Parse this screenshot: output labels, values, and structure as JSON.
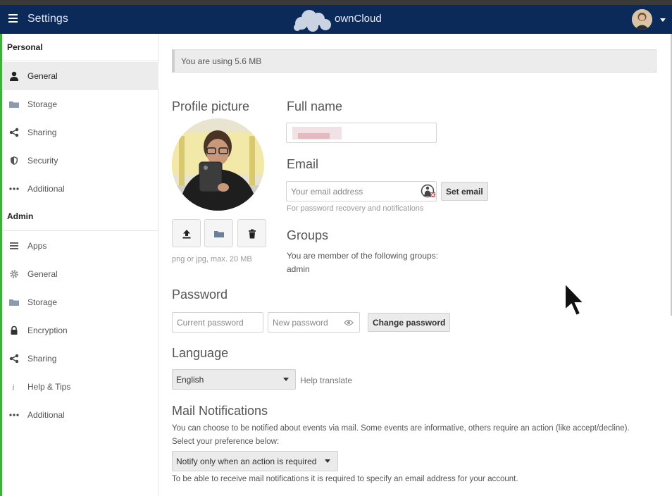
{
  "header": {
    "title": "Settings",
    "brand": "ownCloud",
    "menu_icon": "hamburger-icon",
    "logo_icon": "cloud-logo",
    "user_icon": "user-avatar"
  },
  "sidebar": {
    "personal_heading": "Personal",
    "personal_items": [
      {
        "label": "General",
        "icon": "person-icon",
        "active": true
      },
      {
        "label": "Storage",
        "icon": "folder-icon"
      },
      {
        "label": "Sharing",
        "icon": "share-icon"
      },
      {
        "label": "Security",
        "icon": "shield-icon"
      },
      {
        "label": "Additional",
        "icon": "more-icon"
      }
    ],
    "admin_heading": "Admin",
    "admin_items": [
      {
        "label": "Apps",
        "icon": "list-icon"
      },
      {
        "label": "General",
        "icon": "gear-icon"
      },
      {
        "label": "Storage",
        "icon": "folder-icon"
      },
      {
        "label": "Encryption",
        "icon": "lock-icon"
      },
      {
        "label": "Sharing",
        "icon": "share-icon"
      },
      {
        "label": "Help & Tips",
        "icon": "info-icon"
      },
      {
        "label": "Additional",
        "icon": "more-icon"
      }
    ]
  },
  "usage": "You are using 5.6 MB",
  "profile": {
    "heading": "Profile picture",
    "hint": "png or jpg, max. 20 MB"
  },
  "fullname": {
    "heading": "Full name",
    "value": ""
  },
  "email": {
    "heading": "Email",
    "placeholder": "Your email address",
    "button": "Set email",
    "hint": "For password recovery and notifications"
  },
  "groups": {
    "heading": "Groups",
    "intro": "You are member of the following groups:",
    "list": "admin"
  },
  "password": {
    "heading": "Password",
    "current_placeholder": "Current password",
    "new_placeholder": "New password",
    "button": "Change password"
  },
  "language": {
    "heading": "Language",
    "selected": "English",
    "help": "Help translate"
  },
  "mail": {
    "heading": "Mail Notifications",
    "desc1": "You can choose to be notified about events via mail. Some events are informative, others require an action (like accept/decline).",
    "desc2": "Select your preference below:",
    "selected": "Notify only when an action is required",
    "note": "To be able to receive mail notifications it is required to specify an email address for your account."
  },
  "colors": {
    "header_bg": "#0b2a5a",
    "accent_left": "#3bb33b"
  }
}
